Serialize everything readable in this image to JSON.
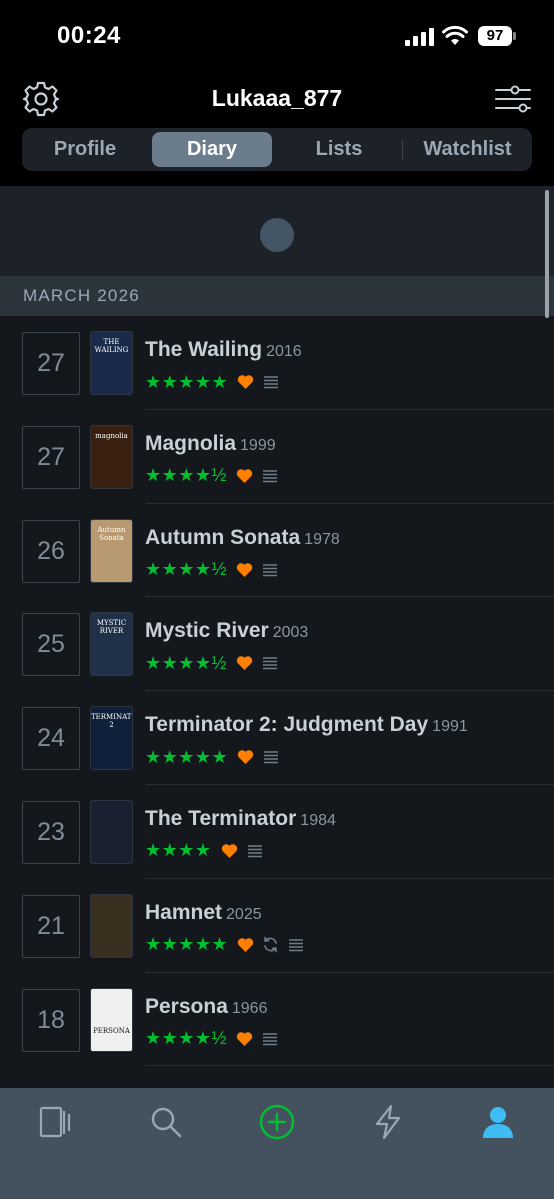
{
  "status_bar": {
    "time": "00:24",
    "battery": "97"
  },
  "header": {
    "username": "Lukaaa_877"
  },
  "tabs": [
    {
      "label": "Profile",
      "active": false
    },
    {
      "label": "Diary",
      "active": true
    },
    {
      "label": "Lists",
      "active": false
    },
    {
      "label": "Watchlist",
      "active": false
    }
  ],
  "month": "MARCH 2026",
  "entries": [
    {
      "day": "27",
      "title": "The Wailing",
      "year": "2016",
      "rating": "★★★★★",
      "liked": true,
      "rewatch": false,
      "review": true,
      "poster_text": "THE WAILING",
      "poster_color": "#1a2a4a"
    },
    {
      "day": "27",
      "title": "Magnolia",
      "year": "1999",
      "rating": "★★★★½",
      "liked": true,
      "rewatch": false,
      "review": true,
      "poster_text": "magnolia",
      "poster_color": "#3a2010"
    },
    {
      "day": "26",
      "title": "Autumn Sonata",
      "year": "1978",
      "rating": "★★★★½",
      "liked": true,
      "rewatch": false,
      "review": true,
      "poster_text": "Autumn Sonata",
      "poster_color": "#b89a70"
    },
    {
      "day": "25",
      "title": "Mystic River",
      "year": "2003",
      "rating": "★★★★½",
      "liked": true,
      "rewatch": false,
      "review": true,
      "poster_text": "MYSTIC RIVER",
      "poster_color": "#203048"
    },
    {
      "day": "24",
      "title": "Terminator 2: Judgment Day",
      "year": "1991",
      "rating": "★★★★★",
      "liked": true,
      "rewatch": false,
      "review": true,
      "poster_text": "TERMINATOR 2",
      "poster_color": "#10203a"
    },
    {
      "day": "23",
      "title": "The Terminator",
      "year": "1984",
      "rating": "★★★★",
      "liked": true,
      "rewatch": false,
      "review": true,
      "poster_text": "",
      "poster_color": "#1a2030"
    },
    {
      "day": "21",
      "title": "Hamnet",
      "year": "2025",
      "rating": "★★★★★",
      "liked": true,
      "rewatch": true,
      "review": true,
      "poster_text": "",
      "poster_color": "#3a3020"
    },
    {
      "day": "18",
      "title": "Persona",
      "year": "1966",
      "rating": "★★★★½",
      "liked": true,
      "rewatch": false,
      "review": true,
      "poster_text": "PERSONA",
      "poster_color": "#f0f0f0"
    }
  ],
  "colors": {
    "accent_green": "#00c030",
    "heart_orange": "#ff8000",
    "active_tab_blue": "#40bcf4"
  }
}
